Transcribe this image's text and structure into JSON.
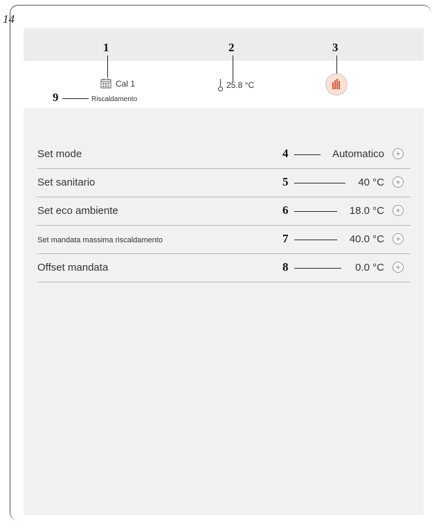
{
  "page_number": "14",
  "header": {
    "callouts": [
      "1",
      "2",
      "3",
      "9"
    ],
    "calendar_label": "Cal 1",
    "mode_label": "Riscaldamento",
    "temperature": "25.8 °C",
    "icons": [
      "calendar-icon",
      "thermometer-icon",
      "flame-status-icon"
    ]
  },
  "settings": [
    {
      "callout": "4",
      "label": "Set mode",
      "value": "Automatico"
    },
    {
      "callout": "5",
      "label": "Set sanitario",
      "value": "40 °C"
    },
    {
      "callout": "6",
      "label": "Set eco ambiente",
      "value": "18.0 °C"
    },
    {
      "callout": "7",
      "label": "Set mandata massima riscaldamento",
      "value": "40.0 °C"
    },
    {
      "callout": "8",
      "label": "Offset mandata",
      "value": "0.0 °C"
    }
  ],
  "colors": {
    "flame_bg": "#fbe0d6",
    "flame": "#d9532b",
    "divider": "#b9b9b9"
  }
}
